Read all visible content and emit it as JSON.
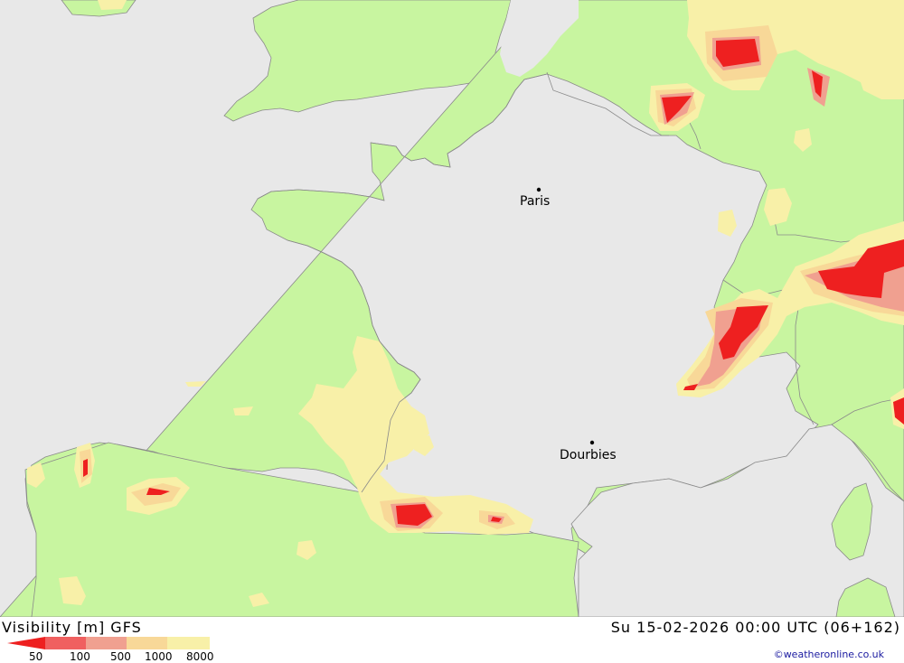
{
  "map": {
    "colors": {
      "sea": "#e8e8e8",
      "land": "#c8f5a0",
      "vis_8000": "#f8f0a8",
      "vis_1000": "#f8d898",
      "vis_500": "#f0a090",
      "vis_100": "#f06060",
      "vis_50": "#ee2020",
      "border": "#8a8a8a"
    },
    "cities": [
      {
        "name": "Paris"
      },
      {
        "name": "Dourbies"
      }
    ]
  },
  "footer": {
    "title": "Visibility [m] GFS",
    "datetime": "Su 15-02-2026 00:00 UTC (06+162)",
    "credit": "©weatheronline.co.uk",
    "legend": {
      "ticks": [
        "50",
        "100",
        "500",
        "1000",
        "8000"
      ],
      "colors": [
        "#ee2020",
        "#f06060",
        "#f0a090",
        "#f8d898",
        "#f8f0a8"
      ]
    }
  }
}
